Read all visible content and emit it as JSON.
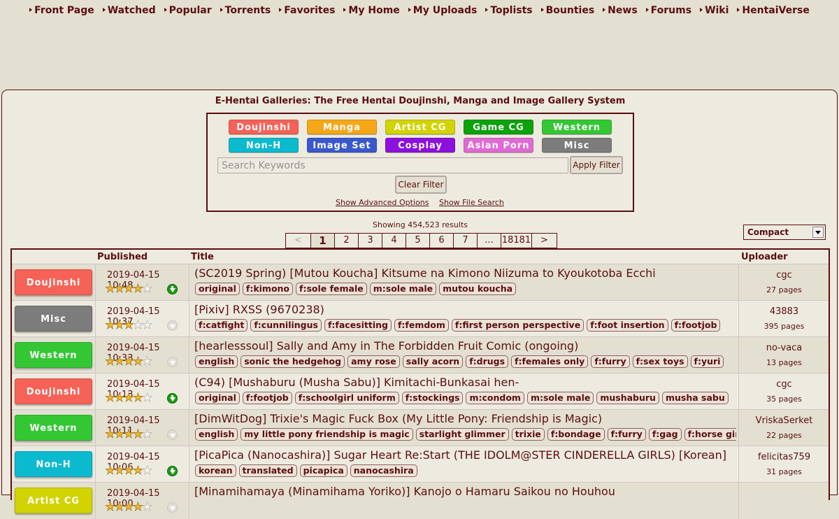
{
  "nav": [
    "Front Page",
    "Watched",
    "Popular",
    "Torrents",
    "Favorites",
    "My Home",
    "My Uploads",
    "Toplists",
    "Bounties",
    "News",
    "Forums",
    "Wiki",
    "HentaiVerse"
  ],
  "site_title": "E-Hentai Galleries: The Free Hentai Doujinshi, Manga and Image Gallery System",
  "categories": [
    {
      "label": "Doujinshi",
      "color": "#f66258"
    },
    {
      "label": "Manga",
      "color": "#f5a718"
    },
    {
      "label": "Artist CG",
      "color": "#d2d303"
    },
    {
      "label": "Game CG",
      "color": "#0ca20c"
    },
    {
      "label": "Western",
      "color": "#34c734"
    },
    {
      "label": "Non-H",
      "color": "#0cbacf"
    },
    {
      "label": "Image Set",
      "color": "#3a58ce"
    },
    {
      "label": "Cosplay",
      "color": "#8c11db"
    },
    {
      "label": "Asian Porn",
      "color": "#e06ad3"
    },
    {
      "label": "Misc",
      "color": "#7c7c7c"
    }
  ],
  "search": {
    "placeholder": "Search Keywords",
    "value": ""
  },
  "buttons": {
    "apply": "Apply Filter",
    "clear": "Clear Filter"
  },
  "links": {
    "advanced": "Show Advanced Options",
    "file": "Show File Search"
  },
  "showing": "Showing 454,523 results",
  "pager": [
    "<",
    "1",
    "2",
    "3",
    "4",
    "5",
    "6",
    "7",
    "...",
    "18181",
    ">"
  ],
  "current_page": "1",
  "view_mode": "Compact",
  "table_headers": {
    "published": "Published",
    "title": "Title",
    "uploader": "Uploader"
  },
  "rows": [
    {
      "category": "Doujinshi",
      "cat_color": "#f66258",
      "date": "2019-04-15 10:48",
      "rating": 4,
      "torrent": true,
      "title": "(SC2019 Spring) [Mutou Koucha] Kitsume na Kimono Niizuma to Kyoukotoba Ecchi",
      "tags": [
        "original",
        "f:kimono",
        "f:sole female",
        "m:sole male",
        "mutou koucha"
      ],
      "uploader": "cgc",
      "pages": "27 pages"
    },
    {
      "category": "Misc",
      "cat_color": "#7c7c7c",
      "date": "2019-04-15 10:37",
      "rating": 3,
      "torrent": false,
      "title": "[Pixiv] RXSS (9670238)",
      "tags": [
        "f:catfight",
        "f:cunnilingus",
        "f:facesitting",
        "f:femdom",
        "f:first person perspective",
        "f:foot insertion",
        "f:footjob"
      ],
      "uploader": "43883",
      "pages": "395 pages"
    },
    {
      "category": "Western",
      "cat_color": "#34c734",
      "date": "2019-04-15 10:33",
      "rating": 4,
      "torrent": false,
      "title": "[hearlesssoul] Sally and Amy in The Forbidden Fruit Comic (ongoing)",
      "tags": [
        "english",
        "sonic the hedgehog",
        "amy rose",
        "sally acorn",
        "f:drugs",
        "f:females only",
        "f:furry",
        "f:sex toys",
        "f:yuri"
      ],
      "uploader": "no-vaca",
      "pages": "13 pages"
    },
    {
      "category": "Doujinshi",
      "cat_color": "#f66258",
      "date": "2019-04-15 10:13",
      "rating": 4,
      "torrent": true,
      "title": "(C94) [Mushaburu (Musha Sabu)] Kimitachi-Bunkasai hen-",
      "tags": [
        "original",
        "f:footjob",
        "f:schoolgirl uniform",
        "f:stockings",
        "m:condom",
        "m:sole male",
        "mushaburu",
        "musha sabu"
      ],
      "uploader": "cgc",
      "pages": "35 pages"
    },
    {
      "category": "Western",
      "cat_color": "#34c734",
      "date": "2019-04-15 10:11",
      "rating": 4,
      "torrent": false,
      "title": "[DimWitDog] Trixie's Magic Fuck Box (My Little Pony: Friendship is Magic)",
      "tags": [
        "english",
        "my little pony friendship is magic",
        "starlight glimmer",
        "trixie",
        "f:bondage",
        "f:furry",
        "f:gag",
        "f:horse girl"
      ],
      "uploader": "VriskaSerket",
      "pages": "22 pages"
    },
    {
      "category": "Non-H",
      "cat_color": "#0cbacf",
      "date": "2019-04-15 10:06",
      "rating": 4,
      "torrent": true,
      "title": "[PicaPica (Nanocashira)] Sugar Heart Re:Start (THE IDOLM@STER CINDERELLA GIRLS) [Korean]",
      "tags": [
        "korean",
        "translated",
        "picapica",
        "nanocashira"
      ],
      "uploader": "felicitas759",
      "pages": "31 pages"
    },
    {
      "category": "Artist CG",
      "cat_color": "#d2d303",
      "date": "2019-04-15 10:00",
      "rating": 4,
      "torrent": false,
      "title": "[Minamihamaya (Minamihama Yoriko)] Kanojo o Hamaru Saikou no Houhou",
      "tags": [],
      "uploader": "",
      "pages": ""
    }
  ]
}
